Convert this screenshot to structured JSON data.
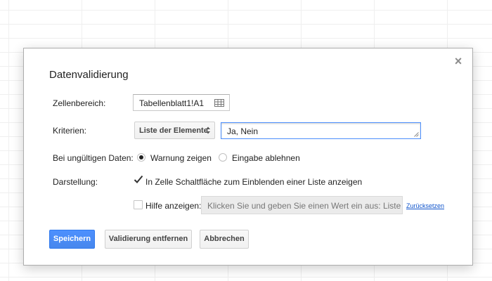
{
  "dialog": {
    "title": "Datenvalidierung",
    "close_glyph": "×"
  },
  "cell_range": {
    "label": "Zellenbereich:",
    "value": "Tabellenblatt1!A1",
    "icon": "grid-icon"
  },
  "criteria": {
    "label": "Kriterien:",
    "type_selected": "Liste der Elemente",
    "value": "Ja, Nein"
  },
  "invalid_data": {
    "label": "Bei ungültigen Daten:",
    "options": [
      {
        "label": "Warnung zeigen",
        "checked": true
      },
      {
        "label": "Eingabe ablehnen",
        "checked": false
      }
    ]
  },
  "appearance": {
    "label": "Darstellung:",
    "show_dropdown": {
      "label": "In Zelle Schaltfläche zum Einblenden einer Liste anzeigen",
      "checked": true
    },
    "show_help": {
      "label": "Hilfe anzeigen:",
      "checked": false
    },
    "help_placeholder": "Klicken Sie und geben Sie einen Wert ein aus: Liste c",
    "reset_link": "Zurücksetzen"
  },
  "buttons": {
    "save": "Speichern",
    "remove": "Validierung entfernen",
    "cancel": "Abbrechen"
  },
  "colors": {
    "primary": "#4d90fe",
    "link": "#1155cc",
    "checkmark": "#333333"
  }
}
